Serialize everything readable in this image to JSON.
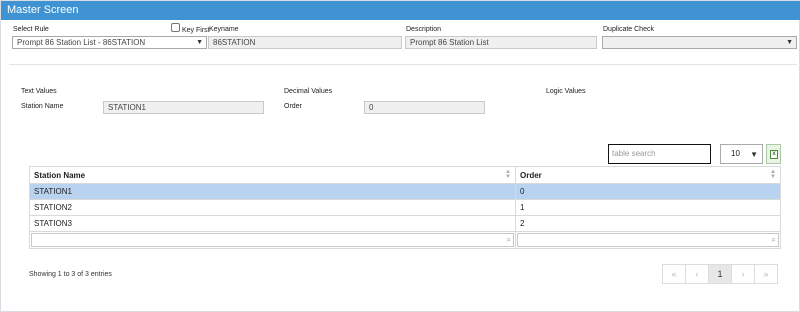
{
  "window": {
    "title": "Master Screen"
  },
  "form": {
    "select_rule_label": "Select Rule",
    "select_rule_value": "Prompt 86 Station List - 86STATION",
    "key_first_label": "Key First",
    "keyname_label": "Keyname",
    "keyname_value": "86STATION",
    "description_label": "Description",
    "description_value": "Prompt 86 Station List",
    "duplicate_check_label": "Duplicate Check",
    "duplicate_check_value": ""
  },
  "sections": {
    "text_values_label": "Text Values",
    "decimal_values_label": "Decimal Values",
    "logic_values_label": "Logic Values",
    "station_name_label": "Station Name",
    "station_name_value": "STATION1",
    "order_label": "Order",
    "order_value": "0"
  },
  "table": {
    "search_placeholder": "table search",
    "page_size": "10",
    "columns": [
      "Station Name",
      "Order"
    ],
    "rows": [
      {
        "name": "STATION1",
        "order": "0",
        "selected": true
      },
      {
        "name": "STATION2",
        "order": "1",
        "selected": false
      },
      {
        "name": "STATION3",
        "order": "2",
        "selected": false
      }
    ],
    "info": "Showing 1 to 3 of 3 entries"
  },
  "pagination": {
    "first": "«",
    "prev": "‹",
    "current": "1",
    "next": "›",
    "last": "»"
  },
  "icons": {
    "excel": "excel-export-icon",
    "search": "magnifier-icon",
    "sort": "sort-icon",
    "dropdown": "chevron-down-icon"
  },
  "colors": {
    "titlebar": "#3f93d3",
    "selected_row": "#b9d2ef"
  }
}
